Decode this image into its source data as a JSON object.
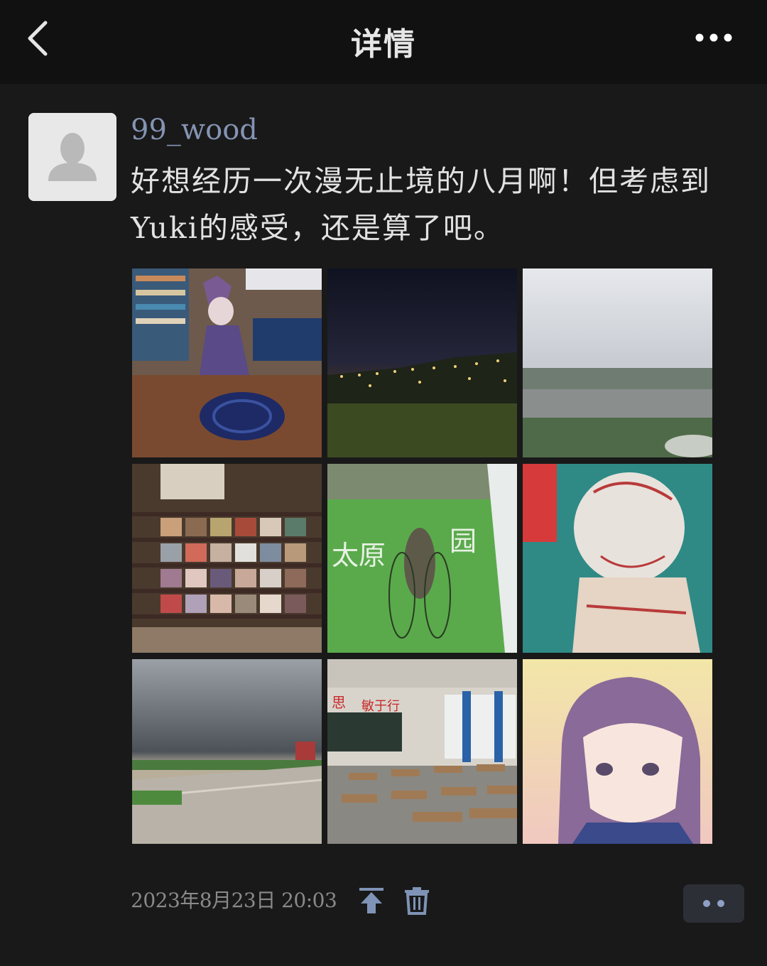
{
  "header": {
    "title": "详情",
    "back_icon": "chevron-left-icon",
    "more_icon": "more-horizontal-icon"
  },
  "post": {
    "username": "99_wood",
    "text": "好想经历一次漫无止境的八月啊！但考虑到Yuki的感受，还是算了吧。",
    "timestamp": "2023年8月23日  20:03",
    "photos": [
      {
        "name": "photo-anime-figure-desk"
      },
      {
        "name": "photo-night-city-lights"
      },
      {
        "name": "photo-aerial-landscape"
      },
      {
        "name": "photo-cd-bookshelf"
      },
      {
        "name": "photo-cicada-on-green-sign"
      },
      {
        "name": "photo-anime-poster-teal"
      },
      {
        "name": "photo-cloudy-plaza"
      },
      {
        "name": "photo-empty-classroom"
      },
      {
        "name": "photo-anime-girl-portrait"
      }
    ]
  },
  "actions": {
    "pin_icon": "pin-to-top-icon",
    "delete_icon": "trash-icon",
    "comment_icon": "more-dots-icon"
  },
  "colors": {
    "background": "#191919",
    "header_bg": "#111111",
    "username": "#8494b4",
    "text": "#e2e2e2",
    "icon_accent": "#7f93b6"
  }
}
